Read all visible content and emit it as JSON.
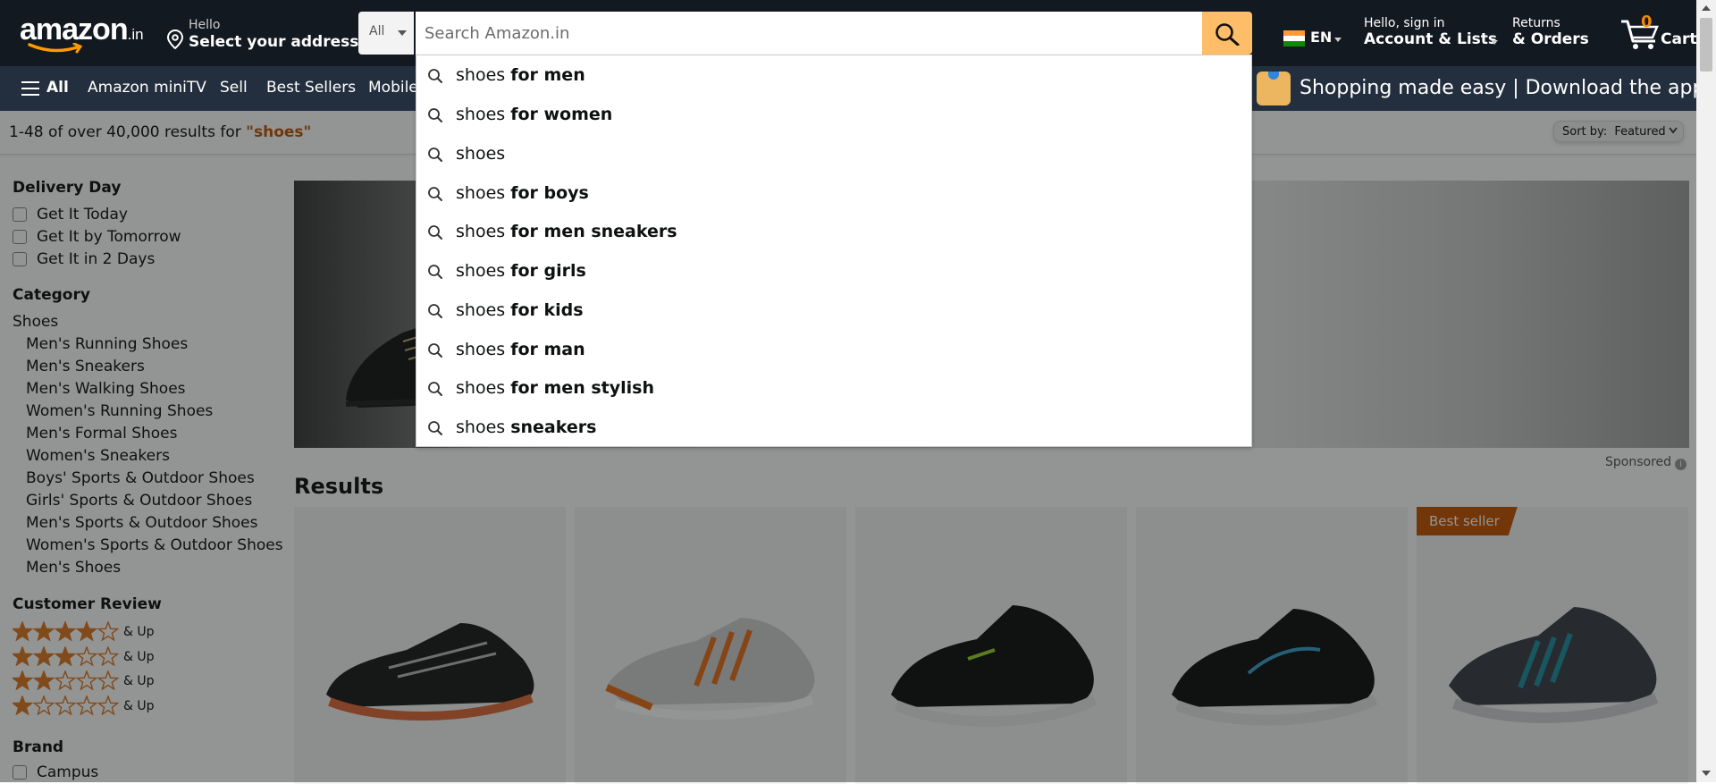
{
  "header": {
    "logo_text": "amazon",
    "logo_suffix": ".in",
    "address_greeting": "Hello",
    "address_label": "Select your address",
    "search_category": "All",
    "search_placeholder": "Search Amazon.in",
    "language": "EN",
    "account_greeting": "Hello, sign in",
    "account_label": "Account & Lists",
    "returns_line1": "Returns",
    "returns_line2": "& Orders",
    "cart_count": "0",
    "cart_label": "Cart"
  },
  "subnav": {
    "all_label": "All",
    "items": [
      "Amazon miniTV",
      "Sell",
      "Best Sellers",
      "Mobiles"
    ],
    "promo_text": "Shopping made easy | Download the app"
  },
  "results_bar": {
    "count_text": "1-48 of over 40,000 results for ",
    "query": "\"shoes\"",
    "sort_prefix": "Sort by:",
    "sort_value": "Featured"
  },
  "sidebar": {
    "delivery_heading": "Delivery Day",
    "delivery_options": [
      "Get It Today",
      "Get It by Tomorrow",
      "Get It in 2 Days"
    ],
    "category_heading": "Category",
    "category_root": "Shoes",
    "categories": [
      "Men's Running Shoes",
      "Men's Sneakers",
      "Men's Walking Shoes",
      "Women's Running Shoes",
      "Men's Formal Shoes",
      "Women's Sneakers",
      "Boys' Sports & Outdoor Shoes",
      "Girls' Sports & Outdoor Shoes",
      "Men's Sports & Outdoor Shoes",
      "Women's Sports & Outdoor Shoes",
      "Men's Shoes"
    ],
    "review_heading": "Customer Review",
    "review_ratings": [
      4,
      3,
      2,
      1
    ],
    "review_suffix": "& Up",
    "brand_heading": "Brand",
    "brands": [
      "Campus"
    ]
  },
  "main": {
    "sponsored_label": "Sponsored",
    "results_heading": "Results",
    "badge_label": "Best seller"
  },
  "suggestions": [
    {
      "prefix": "shoes",
      "suffix": "for men"
    },
    {
      "prefix": "shoes",
      "suffix": "for women"
    },
    {
      "prefix": "shoes",
      "suffix": ""
    },
    {
      "prefix": "shoes",
      "suffix": "for boys"
    },
    {
      "prefix": "shoes",
      "suffix": "for men sneakers"
    },
    {
      "prefix": "shoes",
      "suffix": "for girls"
    },
    {
      "prefix": "shoes",
      "suffix": "for kids"
    },
    {
      "prefix": "shoes",
      "suffix": "for man"
    },
    {
      "prefix": "shoes",
      "suffix": "for men stylish"
    },
    {
      "prefix": "shoes",
      "suffix": "sneakers"
    }
  ],
  "colors": {
    "nav_top": "#131921",
    "nav_sub": "#232f3e",
    "search_button": "#febd69",
    "star": "#de7921",
    "badge": "#c45500",
    "query": "#c45500"
  }
}
